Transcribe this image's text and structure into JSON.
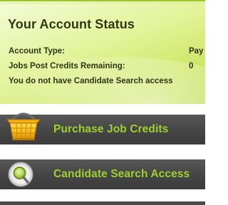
{
  "account_status": {
    "title": "Your Account Status",
    "account_type_label": "Account Type:",
    "account_type_value": "Pay",
    "credits_label": "Jobs Post Credits Remaining:",
    "credits_value": "0",
    "search_access_message": "You do not have Candidate Search access"
  },
  "actions": {
    "purchase_label": "Purchase Job Credits",
    "purchase_icon": "basket-icon",
    "search_label": "Candidate Search Access",
    "search_icon": "magnifier-icon"
  },
  "colors": {
    "accent_green": "#9fd12e",
    "bar_dark": "#464646",
    "panel_green": "#cfe86a"
  }
}
